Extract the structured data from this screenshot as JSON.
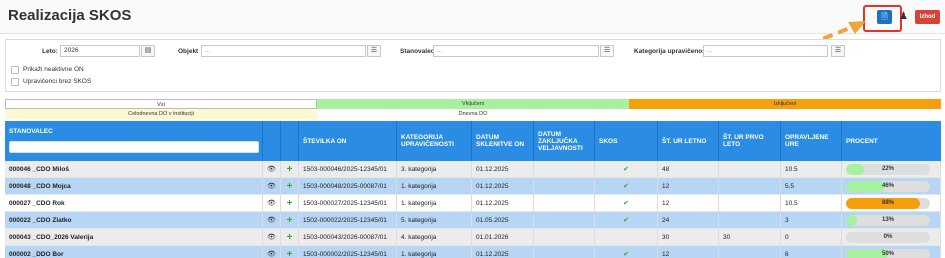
{
  "header": {
    "title": "Realizacija SKOS",
    "doc_icon": "document-icon",
    "users_icon": "users-icon",
    "exit_label": "Izhod",
    "accent": "#1f6fc6",
    "exit_color": "#d9413b"
  },
  "filters": {
    "leto_label": "Leto:",
    "leto_value": "2026",
    "objekt_label": "Objekt",
    "objekt_placeholder": "...",
    "stanovalec_label": "Stanovalec",
    "stanovalec_placeholder": "...",
    "kategorija_label": "Kategorija upravičenosti",
    "kategorija_placeholder": "...",
    "neaktivne_label": "Prikaži neaktivne ON",
    "brez_skos_label": "Upravičenci brez SKOS"
  },
  "legend": {
    "vsi": "Vsi",
    "vkljuceni": "Vključeni",
    "izkljuceni": "Izključeni",
    "celodnevna": "Celodnevna DO v instituciji",
    "dnevna": "Dnevna DO",
    "colors": {
      "vsi": "#ffffff",
      "vkljuceni": "#a6f0a0",
      "izkljuceni": "#f5a00a",
      "celodnevna": "#fdf7d2",
      "dnevna": "#ffffff"
    }
  },
  "grid": {
    "headers": {
      "stanovalec": "STANOVALEC",
      "stevilka": "ŠTEVILKA ON",
      "kategorija": "KATEGORIJA UPRAVIČENOSTI",
      "datum_sklenitve": "DATUM SKLENITVE ON",
      "datum_zakljucka": "DATUM ZAKLJUČKA VELJAVNOSTI",
      "skos": "SKOS",
      "ur_letno": "ŠT. UR LETNO",
      "ur_prvo": "ŠT. UR PRVO LETO",
      "opravljene": "OPRAVLJENE URE",
      "procent": "PROCENT"
    },
    "rows": [
      {
        "name": "000046 _CDO Miloš",
        "stevilka": "1503-000046/2025-12345/01",
        "kategorija": "3. kategorija",
        "datum_sklenitve": "01.12.2025",
        "datum_zakljucka": "",
        "skos": true,
        "ur_letno": "48",
        "ur_prvo": "",
        "opravljene": "10.5",
        "procent": 22,
        "procent_label": "22%",
        "bar_color": "#a6f0a0"
      },
      {
        "name": "000048 _CDO Mojca",
        "stevilka": "1503-000048/2025-00087/01",
        "kategorija": "1. kategorija",
        "datum_sklenitve": "01.12.2025",
        "datum_zakljucka": "",
        "skos": true,
        "ur_letno": "12",
        "ur_prvo": "",
        "opravljene": "5.5",
        "procent": 46,
        "procent_label": "46%",
        "bar_color": "#a6f0a0"
      },
      {
        "name": "000027 _CDO Rok",
        "stevilka": "1503-000027/2025-12345/01",
        "kategorija": "1. kategorija",
        "datum_sklenitve": "01.12.2025",
        "datum_zakljucka": "",
        "skos": true,
        "ur_letno": "12",
        "ur_prvo": "",
        "opravljene": "10.5",
        "procent": 88,
        "procent_label": "88%",
        "bar_color": "#f5a00a"
      },
      {
        "name": "000022 _CDO Zlatko",
        "stevilka": "1502-000022/2025-12345/01",
        "kategorija": "5. kategorija",
        "datum_sklenitve": "01.05.2025",
        "datum_zakljucka": "",
        "skos": true,
        "ur_letno": "24",
        "ur_prvo": "",
        "opravljene": "3",
        "procent": 13,
        "procent_label": "13%",
        "bar_color": "#a6f0a0"
      },
      {
        "name": "000043 _CDO_2026 Valerija",
        "stevilka": "1503-000043/2026-00087/01",
        "kategorija": "4. kategorija",
        "datum_sklenitve": "01.01.2026",
        "datum_zakljucka": "",
        "skos": false,
        "ur_letno": "30",
        "ur_prvo": "30",
        "opravljene": "0",
        "procent": 0,
        "procent_label": "0%",
        "bar_color": "#a6f0a0"
      },
      {
        "name": "000002 _DDO Bor",
        "stevilka": "1503-000002/2025-12345/01",
        "kategorija": "1. kategorija",
        "datum_sklenitve": "01.12.2025",
        "datum_zakljucka": "",
        "skos": true,
        "ur_letno": "12",
        "ur_prvo": "",
        "opravljene": "6",
        "procent": 50,
        "procent_label": "50%",
        "bar_color": "#a6f0a0"
      }
    ]
  }
}
